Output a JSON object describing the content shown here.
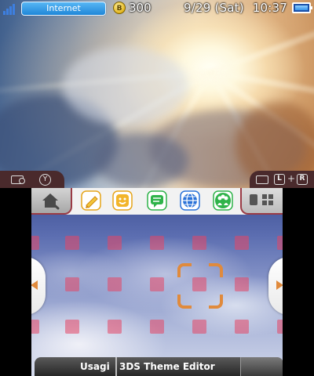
{
  "status_bar": {
    "connection_label": "Internet",
    "coin_symbol": "B",
    "coin_count": "300",
    "date": "9/29 (Sat)",
    "time": "10:37",
    "signal_bars": 4,
    "battery_level": 1.0
  },
  "top_buttons": {
    "left_button_glyph": "Y",
    "right_l_glyph": "L",
    "right_plus": "+",
    "right_r_glyph": "R"
  },
  "toolbar": {
    "settings_icon": "settings-house-wrench-icon",
    "apps": [
      {
        "name": "notes-pencil-icon",
        "color": "#f2b52b"
      },
      {
        "name": "miiverse-smiley-icon",
        "color": "#f2b52b"
      },
      {
        "name": "chat-bubble-icon",
        "color": "#2fb34a"
      },
      {
        "name": "internet-browser-icon",
        "color": "#2a72d8"
      },
      {
        "name": "friends-list-icon",
        "color": "#2fb34a"
      }
    ],
    "view_icons": [
      "small-icons-view-icon",
      "grid-view-icon"
    ]
  },
  "bottom_bar": {
    "user_name": "Usagi",
    "app_title": "3DS Theme Editor"
  },
  "colors": {
    "tile": "#e64664",
    "cursor": "#e08a3c",
    "tab_border": "#9a3b45"
  }
}
